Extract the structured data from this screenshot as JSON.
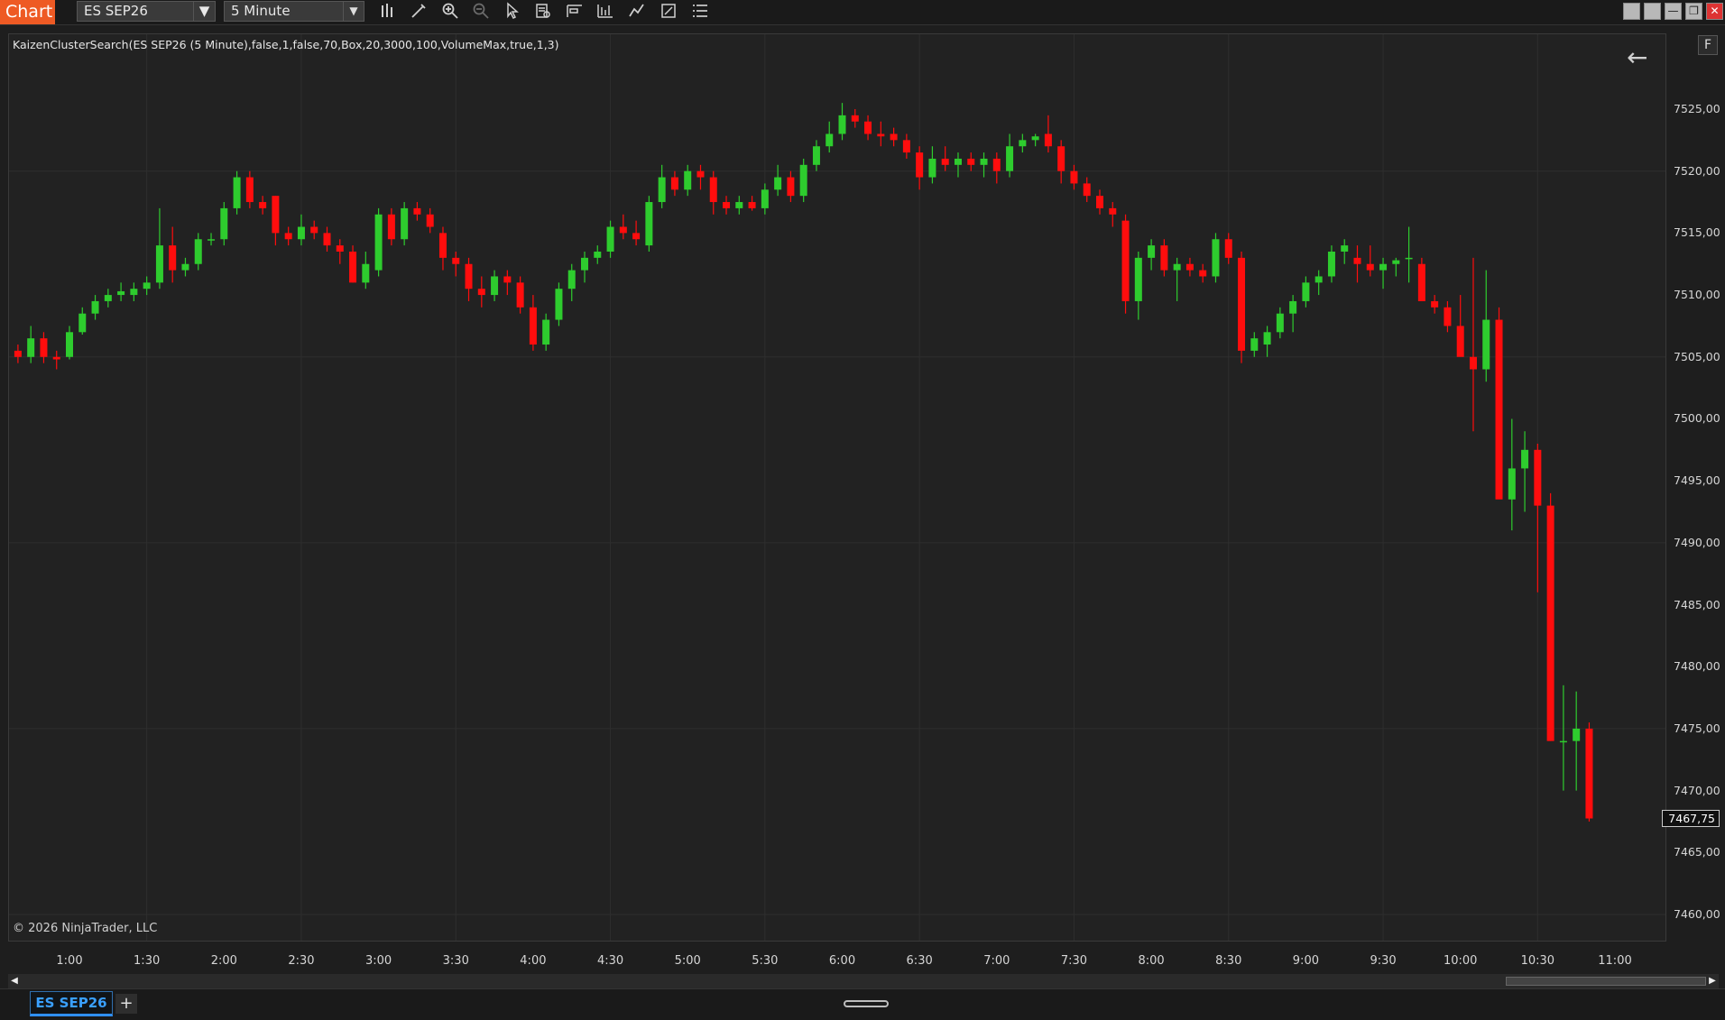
{
  "topbar": {
    "title": "Chart",
    "instrument": "ES SEP26",
    "interval": "5 Minute",
    "tools": [
      "bars-icon",
      "pencil-icon",
      "zoom-in-icon",
      "zoom-out-icon",
      "pointer-icon",
      "data-box-icon",
      "properties-icon",
      "indicators-icon",
      "strategies-icon",
      "snapshot-icon",
      "list-icon"
    ]
  },
  "indicator_label": "KaizenClusterSearch(ES SEP26 (5 Minute),false,1,false,70,Box,20,3000,100,VolumeMax,true,1,3)",
  "copyright": "© 2026 NinjaTrader, LLC",
  "f_button": "F",
  "tabs": {
    "active": "ES SEP26",
    "add": "+"
  },
  "colors": {
    "up": "#2ecc2e",
    "down": "#ff0d0d",
    "grid": "#2e2e2e",
    "background": "#222222"
  },
  "chart_data": {
    "type": "candlestick",
    "instrument": "ES SEP26",
    "interval": "5 Minute",
    "current_price": "7467,75",
    "y_ticks": [
      "7525,00",
      "7520,00",
      "7515,00",
      "7510,00",
      "7505,00",
      "7500,00",
      "7495,00",
      "7490,00",
      "7485,00",
      "7480,00",
      "7475,00",
      "7470,00",
      "7465,00",
      "7460,00"
    ],
    "ylim": [
      7458,
      7530
    ],
    "x_ticks": [
      "1:00",
      "1:30",
      "2:00",
      "2:30",
      "3:00",
      "3:30",
      "4:00",
      "4:30",
      "5:00",
      "5:30",
      "6:00",
      "6:30",
      "7:00",
      "7:30",
      "8:00",
      "8:30",
      "9:00",
      "9:30",
      "10:00",
      "10:30",
      "11:00"
    ],
    "x_start": "0:35",
    "bar_minutes": 5,
    "candles": [
      [
        7505.0,
        7506.5,
        7504.0,
        7505.5
      ],
      [
        7505.5,
        7506.0,
        7504.5,
        7505.0
      ],
      [
        7505.0,
        7507.5,
        7504.5,
        7506.5
      ],
      [
        7506.5,
        7507.0,
        7504.5,
        7505.0
      ],
      [
        7505.0,
        7505.5,
        7504.0,
        7504.8
      ],
      [
        7505.0,
        7507.5,
        7504.8,
        7507.0
      ],
      [
        7507.0,
        7509.0,
        7506.8,
        7508.5
      ],
      [
        7508.5,
        7510.0,
        7508.0,
        7509.5
      ],
      [
        7509.5,
        7510.5,
        7509.0,
        7510.0
      ],
      [
        7510.0,
        7511.0,
        7509.5,
        7510.3
      ],
      [
        7510.0,
        7511.0,
        7509.5,
        7510.5
      ],
      [
        7510.5,
        7511.5,
        7510.0,
        7511.0
      ],
      [
        7511.0,
        7517.0,
        7510.5,
        7514.0
      ],
      [
        7514.0,
        7515.5,
        7511.0,
        7512.0
      ],
      [
        7512.0,
        7513.0,
        7511.5,
        7512.5
      ],
      [
        7512.5,
        7515.0,
        7512.0,
        7514.5
      ],
      [
        7514.5,
        7515.0,
        7514.0,
        7514.5
      ],
      [
        7514.5,
        7517.5,
        7514.0,
        7517.0
      ],
      [
        7517.0,
        7520.0,
        7516.5,
        7519.5
      ],
      [
        7519.5,
        7520.0,
        7517.0,
        7517.5
      ],
      [
        7517.5,
        7518.0,
        7516.5,
        7517.0
      ],
      [
        7518.0,
        7518.0,
        7514.0,
        7515.0
      ],
      [
        7515.0,
        7515.5,
        7514.0,
        7514.5
      ],
      [
        7514.5,
        7516.5,
        7514.0,
        7515.5
      ],
      [
        7515.5,
        7516.0,
        7514.5,
        7515.0
      ],
      [
        7515.0,
        7515.5,
        7513.5,
        7514.0
      ],
      [
        7514.0,
        7514.5,
        7512.5,
        7513.5
      ],
      [
        7513.5,
        7514.0,
        7511.0,
        7511.0
      ],
      [
        7511.0,
        7513.5,
        7510.5,
        7512.5
      ],
      [
        7512.0,
        7517.0,
        7511.5,
        7516.5
      ],
      [
        7516.5,
        7517.0,
        7514.0,
        7514.5
      ],
      [
        7514.5,
        7517.5,
        7514.0,
        7517.0
      ],
      [
        7517.0,
        7517.5,
        7516.0,
        7516.5
      ],
      [
        7516.5,
        7517.0,
        7515.0,
        7515.5
      ],
      [
        7515.0,
        7515.5,
        7512.0,
        7513.0
      ],
      [
        7513.0,
        7513.5,
        7511.5,
        7512.5
      ],
      [
        7512.5,
        7513.0,
        7509.5,
        7510.5
      ],
      [
        7510.5,
        7511.5,
        7509.0,
        7510.0
      ],
      [
        7510.0,
        7512.0,
        7509.5,
        7511.5
      ],
      [
        7511.5,
        7512.0,
        7510.0,
        7511.0
      ],
      [
        7511.0,
        7511.5,
        7508.5,
        7509.0
      ],
      [
        7509.0,
        7510.0,
        7505.5,
        7506.0
      ],
      [
        7506.0,
        7508.5,
        7505.5,
        7508.0
      ],
      [
        7508.0,
        7511.0,
        7507.5,
        7510.5
      ],
      [
        7510.5,
        7512.5,
        7509.5,
        7512.0
      ],
      [
        7512.0,
        7513.5,
        7511.0,
        7513.0
      ],
      [
        7513.0,
        7514.0,
        7512.5,
        7513.5
      ],
      [
        7513.5,
        7516.0,
        7513.0,
        7515.5
      ],
      [
        7515.5,
        7516.5,
        7514.5,
        7515.0
      ],
      [
        7515.0,
        7516.0,
        7514.0,
        7514.5
      ],
      [
        7514.0,
        7518.0,
        7513.5,
        7517.5
      ],
      [
        7517.5,
        7520.5,
        7517.0,
        7519.5
      ],
      [
        7519.5,
        7520.0,
        7518.0,
        7518.5
      ],
      [
        7518.5,
        7520.5,
        7518.0,
        7520.0
      ],
      [
        7520.0,
        7520.5,
        7518.5,
        7519.5
      ],
      [
        7519.5,
        7520.0,
        7516.5,
        7517.5
      ],
      [
        7517.5,
        7518.0,
        7516.5,
        7517.0
      ],
      [
        7517.0,
        7518.0,
        7516.5,
        7517.5
      ],
      [
        7517.5,
        7518.0,
        7516.8,
        7517.0
      ],
      [
        7517.0,
        7519.0,
        7516.5,
        7518.5
      ],
      [
        7518.5,
        7520.5,
        7518.0,
        7519.5
      ],
      [
        7519.5,
        7520.0,
        7517.5,
        7518.0
      ],
      [
        7518.0,
        7521.0,
        7517.5,
        7520.5
      ],
      [
        7520.5,
        7522.5,
        7520.0,
        7522.0
      ],
      [
        7522.0,
        7524.0,
        7521.5,
        7523.0
      ],
      [
        7523.0,
        7525.5,
        7522.5,
        7524.5
      ],
      [
        7524.5,
        7525.0,
        7523.5,
        7524.0
      ],
      [
        7524.0,
        7524.5,
        7522.5,
        7523.0
      ],
      [
        7523.0,
        7524.0,
        7522.0,
        7522.8
      ],
      [
        7523.0,
        7523.5,
        7522.0,
        7522.5
      ],
      [
        7522.5,
        7523.0,
        7521.0,
        7521.5
      ],
      [
        7521.5,
        7522.0,
        7518.5,
        7519.5
      ],
      [
        7519.5,
        7522.0,
        7519.0,
        7521.0
      ],
      [
        7521.0,
        7522.0,
        7520.0,
        7520.5
      ],
      [
        7520.5,
        7521.5,
        7519.5,
        7521.0
      ],
      [
        7521.0,
        7521.5,
        7520.0,
        7520.5
      ],
      [
        7520.5,
        7521.5,
        7519.5,
        7521.0
      ],
      [
        7521.0,
        7521.5,
        7519.0,
        7520.0
      ],
      [
        7520.0,
        7523.0,
        7519.5,
        7522.0
      ],
      [
        7522.0,
        7523.0,
        7521.5,
        7522.5
      ],
      [
        7522.5,
        7523.0,
        7522.0,
        7522.8
      ],
      [
        7523.0,
        7524.5,
        7521.5,
        7522.0
      ],
      [
        7522.0,
        7522.5,
        7519.0,
        7520.0
      ],
      [
        7520.0,
        7520.5,
        7518.5,
        7519.0
      ],
      [
        7519.0,
        7519.5,
        7517.5,
        7518.0
      ],
      [
        7518.0,
        7518.5,
        7516.5,
        7517.0
      ],
      [
        7517.0,
        7517.5,
        7515.5,
        7516.5
      ],
      [
        7516.0,
        7516.5,
        7508.5,
        7509.5
      ],
      [
        7509.5,
        7513.5,
        7508.0,
        7513.0
      ],
      [
        7513.0,
        7514.5,
        7512.0,
        7514.0
      ],
      [
        7514.0,
        7514.5,
        7511.5,
        7512.0
      ],
      [
        7512.0,
        7513.0,
        7509.5,
        7512.5
      ],
      [
        7512.5,
        7513.0,
        7511.5,
        7512.0
      ],
      [
        7512.0,
        7512.5,
        7511.0,
        7511.5
      ],
      [
        7511.5,
        7515.0,
        7511.0,
        7514.5
      ],
      [
        7514.5,
        7515.0,
        7512.5,
        7513.0
      ],
      [
        7513.0,
        7513.5,
        7504.5,
        7505.5
      ],
      [
        7505.5,
        7507.0,
        7505.0,
        7506.5
      ],
      [
        7506.0,
        7507.5,
        7505.0,
        7507.0
      ],
      [
        7507.0,
        7509.0,
        7506.5,
        7508.5
      ],
      [
        7508.5,
        7510.0,
        7507.0,
        7509.5
      ],
      [
        7509.5,
        7511.5,
        7509.0,
        7511.0
      ],
      [
        7511.0,
        7512.0,
        7510.0,
        7511.5
      ],
      [
        7511.5,
        7514.0,
        7511.0,
        7513.5
      ],
      [
        7513.5,
        7514.5,
        7512.5,
        7514.0
      ],
      [
        7513.0,
        7514.0,
        7511.0,
        7512.5
      ],
      [
        7512.5,
        7514.0,
        7511.5,
        7512.0
      ],
      [
        7512.0,
        7513.0,
        7510.5,
        7512.5
      ],
      [
        7512.5,
        7513.0,
        7511.5,
        7512.8
      ],
      [
        7513.0,
        7515.5,
        7511.0,
        7513.0
      ],
      [
        7512.5,
        7513.0,
        7509.5,
        7509.5
      ],
      [
        7509.5,
        7510.0,
        7508.5,
        7509.0
      ],
      [
        7509.0,
        7509.5,
        7507.0,
        7507.5
      ],
      [
        7507.5,
        7510.0,
        7505.5,
        7505.0
      ],
      [
        7505.0,
        7513.0,
        7499.0,
        7504.0
      ],
      [
        7504.0,
        7512.0,
        7503.0,
        7508.0
      ],
      [
        7508.0,
        7509.0,
        7494.0,
        7493.5
      ],
      [
        7493.5,
        7500.0,
        7491.0,
        7496.0
      ],
      [
        7496.0,
        7499.0,
        7492.5,
        7497.5
      ],
      [
        7497.5,
        7498.0,
        7486.0,
        7493.0
      ],
      [
        7493.0,
        7494.0,
        7474.0,
        7474.0
      ],
      [
        7474.0,
        7478.5,
        7470.0,
        7474.0
      ],
      [
        7474.0,
        7478.0,
        7470.0,
        7475.0
      ],
      [
        7475.0,
        7475.5,
        7467.5,
        7467.75
      ]
    ]
  }
}
